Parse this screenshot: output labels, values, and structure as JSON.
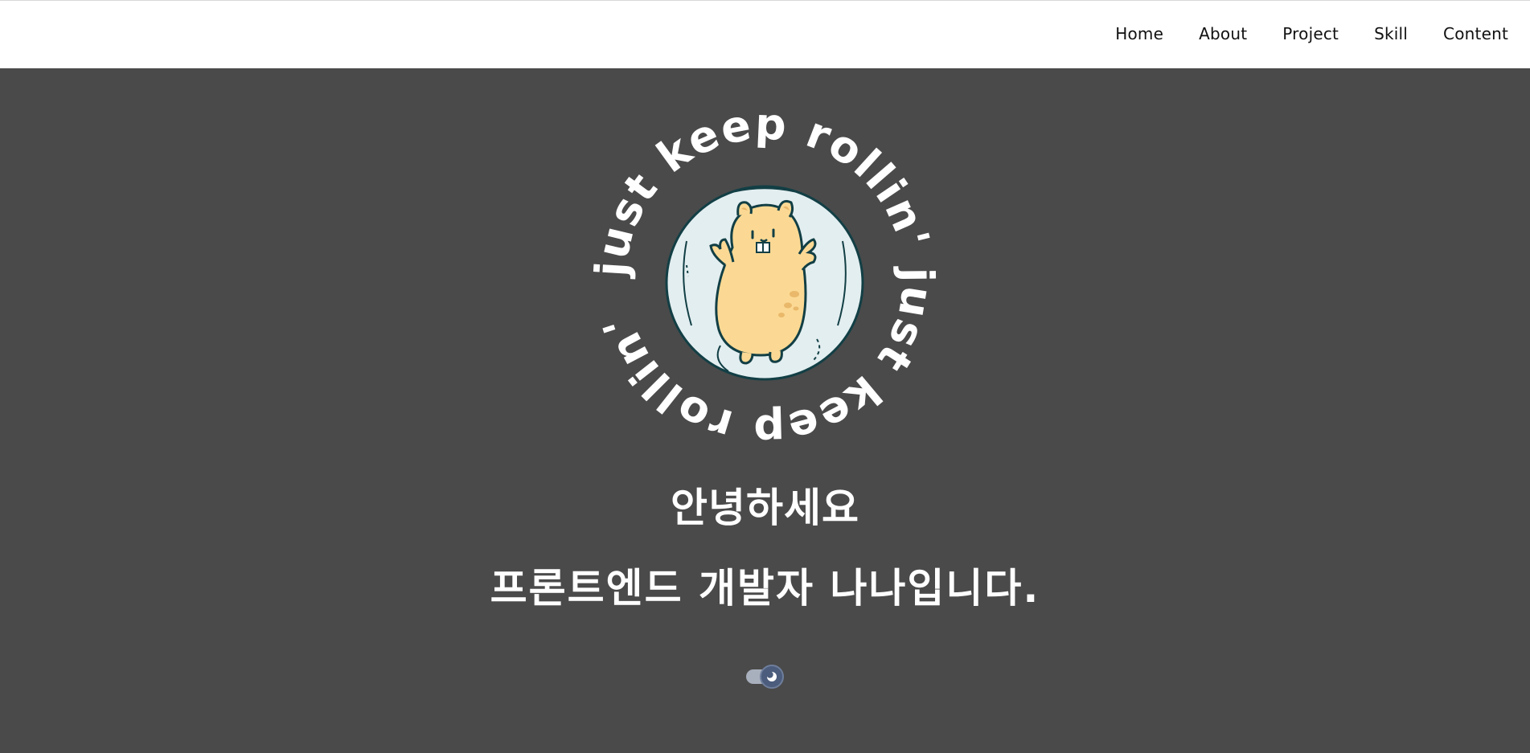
{
  "nav": {
    "items": [
      {
        "label": "Home"
      },
      {
        "label": "About"
      },
      {
        "label": "Project"
      },
      {
        "label": "Skill"
      },
      {
        "label": "Content"
      }
    ]
  },
  "hero": {
    "logo": {
      "ring_text": "just keep rollin' just keep rollin'",
      "icon": "hamster-ball-icon"
    },
    "greeting": "안녕하세요",
    "intro": "프론트엔드 개발자 나나입니다."
  },
  "theme_toggle": {
    "state": "dark",
    "icon": "moon-icon"
  },
  "colors": {
    "navbar_bg": "#ffffff",
    "page_bg": "#4a4a4a",
    "text_light": "#ffffff",
    "hamster_fill": "#fbd994",
    "ball_fill": "#e3eef0",
    "outline": "#123f45"
  }
}
